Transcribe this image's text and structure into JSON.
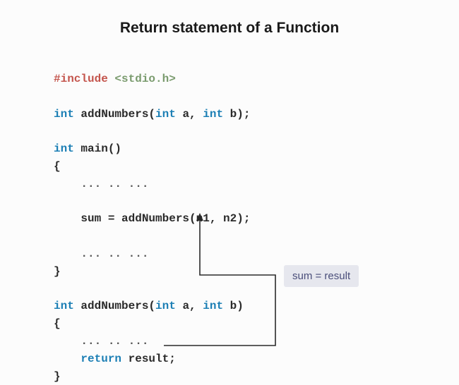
{
  "title": "Return statement of a Function",
  "code": {
    "line1_directive": "#include",
    "line1_include": " <stdio.h>",
    "line3_type1": "int",
    "line3_fn": " addNumbers(",
    "line3_type2": "int",
    "line3_a": " a, ",
    "line3_type3": "int",
    "line3_b": " b);",
    "line5_type": "int",
    "line5_main": " main()",
    "line6_brace": "{",
    "line7_ellipsis": "    ... .. ...",
    "line9_call": "    sum = addNumbers(n1, n2);",
    "line11_ellipsis": "    ... .. ...",
    "line12_brace": "}",
    "line14_type1": "int",
    "line14_fn": " addNumbers(",
    "line14_type2": "int",
    "line14_a": " a, ",
    "line14_type3": "int",
    "line14_b": " b)",
    "line15_brace": "{",
    "line16_ellipsis": "    ... .. ...",
    "line17_return": "    return",
    "line17_result": " result;",
    "line18_brace": "}"
  },
  "annotation": "sum = result"
}
